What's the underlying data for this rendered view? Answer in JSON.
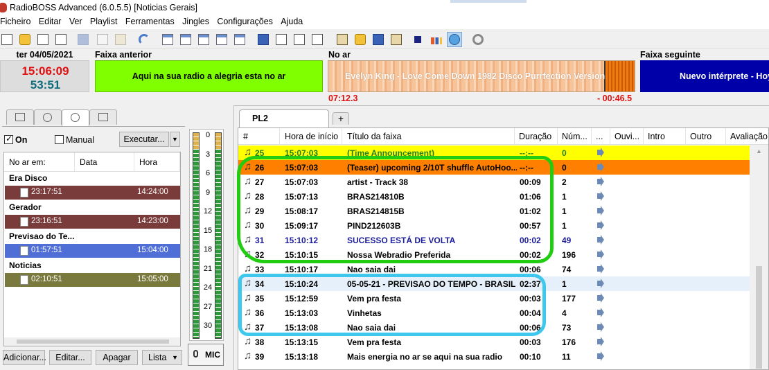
{
  "window": {
    "title": "RadioBOSS Advanced (6.0.5.5) [Noticias Gerais]"
  },
  "menu": [
    "Ficheiro",
    "Editar",
    "Ver",
    "Playlist",
    "Ferramentas",
    "Jingles",
    "Configurações",
    "Ajuda"
  ],
  "clock": {
    "date": "ter 04/05/2021",
    "time": "15:06:09",
    "remaining": "53:51"
  },
  "previous": {
    "label": "Faixa anterior",
    "text": "Aqui na sua radio a alegria esta no ar"
  },
  "on_air": {
    "label": "No ar",
    "track": "Evelyn King - Love Come Down 1982 Disco Purrfection Version",
    "elapsed": "07:12.3",
    "remaining": "- 00:46.5",
    "progress": 0.9
  },
  "next": {
    "label": "Faixa seguinte",
    "text": "Nuevo intérprete - Hoy"
  },
  "scheduler": {
    "on_label": "On",
    "on_checked": true,
    "manual_label": "Manual",
    "manual_checked": false,
    "execute_label": "Executar...",
    "columns": [
      "No ar em:",
      "Data",
      "Hora"
    ],
    "groups": [
      {
        "name": "Era Disco",
        "row_time": "23:17:51",
        "hour": "14:24:00",
        "color": "#7a3b3b"
      },
      {
        "name": "Gerador",
        "row_time": "23:16:51",
        "hour": "14:23:00",
        "color": "#7a3b3b"
      },
      {
        "name": "Previsao do Te...",
        "row_time": "01:57:51",
        "hour": "15:04:00",
        "color": "#4f6fd6"
      },
      {
        "name": "Noticias",
        "row_time": "02:10:51",
        "hour": "15:05:00",
        "color": "#7a7a3e"
      }
    ],
    "buttons": {
      "add": "Adicionar...",
      "edit": "Editar...",
      "delete": "Apagar",
      "list": "Lista"
    }
  },
  "vu": {
    "labels": [
      "0",
      "3",
      "6",
      "9",
      "12",
      "15",
      "18",
      "21",
      "24",
      "27",
      "30"
    ],
    "mic_label": "MIC"
  },
  "playlist": {
    "tab": "PL2",
    "columns": [
      "#",
      "Hora de início",
      "Título da faixa",
      "Duração",
      "Núm...",
      "...",
      "Ouvi...",
      "Intro",
      "Outro",
      "Avaliação"
    ],
    "rows": [
      {
        "n": "25",
        "start": "15:07:03",
        "title": "(Time Announcement)",
        "dur": "--:--",
        "count": "0",
        "bg": "#ffff00",
        "fg": "#208020"
      },
      {
        "n": "26",
        "start": "15:07:03",
        "title": "(Teaser) upcoming 2/10T shuffle AutoHoo...",
        "dur": "--:--",
        "count": "0",
        "bg": "#ff8000",
        "fg": "#000000"
      },
      {
        "n": "27",
        "start": "15:07:03",
        "title": "artist - Track 38",
        "dur": "00:09",
        "count": "2",
        "bg": "#ffffff",
        "fg": "#000000"
      },
      {
        "n": "28",
        "start": "15:07:13",
        "title": "BRAS214810B",
        "dur": "01:06",
        "count": "1",
        "bg": "#ffffff",
        "fg": "#000000"
      },
      {
        "n": "29",
        "start": "15:08:17",
        "title": "BRAS214815B",
        "dur": "01:02",
        "count": "1",
        "bg": "#ffffff",
        "fg": "#000000"
      },
      {
        "n": "30",
        "start": "15:09:17",
        "title": "PIND212603B",
        "dur": "00:57",
        "count": "1",
        "bg": "#ffffff",
        "fg": "#000000"
      },
      {
        "n": "31",
        "start": "15:10:12",
        "title": "SUCESSO ESTÁ DE VOLTA",
        "dur": "00:02",
        "count": "49",
        "bg": "#ffffff",
        "fg": "#1c1c9c"
      },
      {
        "n": "32",
        "start": "15:10:15",
        "title": "Nossa Webradio Preferida",
        "dur": "00:02",
        "count": "196",
        "bg": "#ffffff",
        "fg": "#000000"
      },
      {
        "n": "33",
        "start": "15:10:17",
        "title": "Nao saia dai",
        "dur": "00:06",
        "count": "74",
        "bg": "#ffffff",
        "fg": "#000000"
      },
      {
        "n": "34",
        "start": "15:10:24",
        "title": "05-05-21 - PREVISAO DO TEMPO - BRASIL",
        "dur": "02:37",
        "count": "1",
        "bg": "#e6f0fa",
        "fg": "#000000"
      },
      {
        "n": "35",
        "start": "15:12:59",
        "title": "Vem pra festa",
        "dur": "00:03",
        "count": "177",
        "bg": "#ffffff",
        "fg": "#000000"
      },
      {
        "n": "36",
        "start": "15:13:03",
        "title": "Vinhetas",
        "dur": "00:04",
        "count": "4",
        "bg": "#ffffff",
        "fg": "#000000"
      },
      {
        "n": "37",
        "start": "15:13:08",
        "title": "Nao saia dai",
        "dur": "00:06",
        "count": "73",
        "bg": "#ffffff",
        "fg": "#000000"
      },
      {
        "n": "38",
        "start": "15:13:15",
        "title": "Vem pra festa",
        "dur": "00:03",
        "count": "176",
        "bg": "#ffffff",
        "fg": "#000000"
      },
      {
        "n": "39",
        "start": "15:13:18",
        "title": "Mais energia no ar se aqui na sua radio",
        "dur": "00:10",
        "count": "11",
        "bg": "#ffffff",
        "fg": "#000000"
      }
    ]
  },
  "annotations": {
    "green": "#22cc11",
    "blue": "#3ec8ee"
  }
}
